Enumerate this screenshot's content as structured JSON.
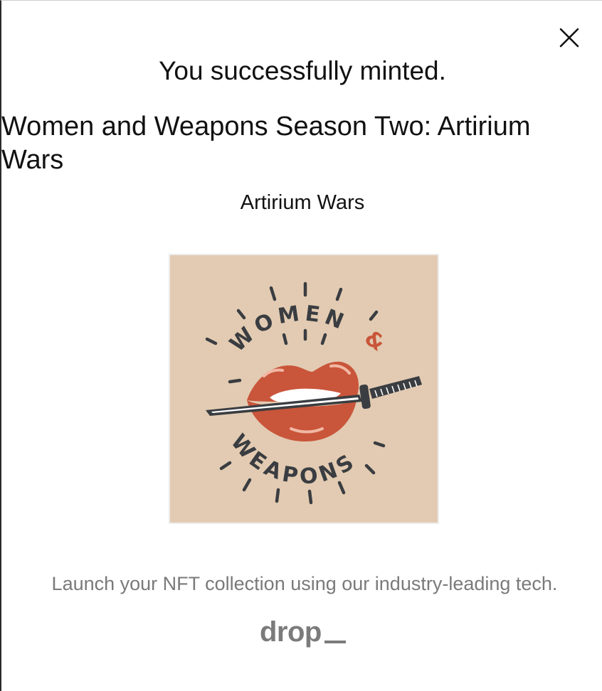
{
  "background": {
    "peek_text": "——————— ——— ————————— ———— ——"
  },
  "modal": {
    "close_icon": "close-icon",
    "title": "You successfully minted.",
    "collection_name": "Women and Weapons Season Two: Artirium Wars",
    "token_name": "Artirium Wars",
    "image": {
      "artwork_top_text": "WOMEN",
      "artwork_ampersand": "&",
      "artwork_bottom_text": "WEAPONS",
      "background_color": "#e2cbb2",
      "lips_color": "#c9553a",
      "ink_color": "#3a3d41"
    },
    "promo_text": "Launch your NFT collection using our industry-leading tech.",
    "brand": {
      "name": "drop",
      "color": "#7b7b7b"
    }
  }
}
